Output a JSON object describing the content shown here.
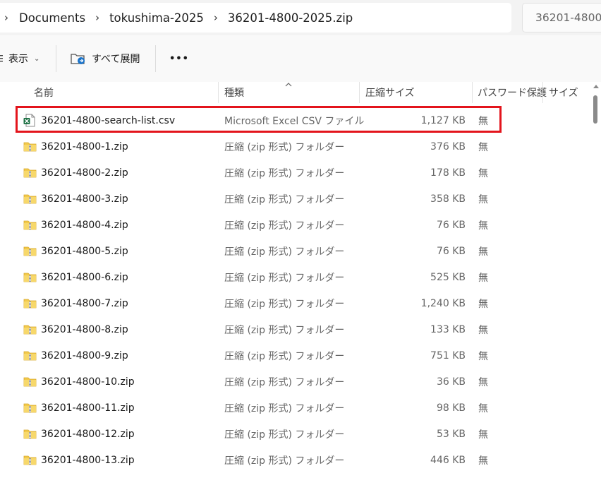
{
  "address": {
    "crumbs": [
      "Documents",
      "tokushima-2025",
      "36201-4800-2025.zip"
    ],
    "search_placeholder": "36201-4800"
  },
  "toolbar": {
    "view_label": "表示",
    "expand_all_label": "すべて展開",
    "more_label": "•••"
  },
  "columns": {
    "name": "名前",
    "type": "種類",
    "compressed_size": "圧縮サイズ",
    "password": "パスワード保護",
    "size": "サイズ"
  },
  "files": [
    {
      "name": "36201-4800-search-list.csv",
      "type": "Microsoft Excel CSV ファイル",
      "size": "1,127 KB",
      "password": "無",
      "icon": "excel-csv-icon"
    },
    {
      "name": "36201-4800-1.zip",
      "type": "圧縮 (zip 形式) フォルダー",
      "size": "376 KB",
      "password": "無",
      "icon": "zip-folder-icon"
    },
    {
      "name": "36201-4800-2.zip",
      "type": "圧縮 (zip 形式) フォルダー",
      "size": "178 KB",
      "password": "無",
      "icon": "zip-folder-icon"
    },
    {
      "name": "36201-4800-3.zip",
      "type": "圧縮 (zip 形式) フォルダー",
      "size": "358 KB",
      "password": "無",
      "icon": "zip-folder-icon"
    },
    {
      "name": "36201-4800-4.zip",
      "type": "圧縮 (zip 形式) フォルダー",
      "size": "76 KB",
      "password": "無",
      "icon": "zip-folder-icon"
    },
    {
      "name": "36201-4800-5.zip",
      "type": "圧縮 (zip 形式) フォルダー",
      "size": "76 KB",
      "password": "無",
      "icon": "zip-folder-icon"
    },
    {
      "name": "36201-4800-6.zip",
      "type": "圧縮 (zip 形式) フォルダー",
      "size": "525 KB",
      "password": "無",
      "icon": "zip-folder-icon"
    },
    {
      "name": "36201-4800-7.zip",
      "type": "圧縮 (zip 形式) フォルダー",
      "size": "1,240 KB",
      "password": "無",
      "icon": "zip-folder-icon"
    },
    {
      "name": "36201-4800-8.zip",
      "type": "圧縮 (zip 形式) フォルダー",
      "size": "133 KB",
      "password": "無",
      "icon": "zip-folder-icon"
    },
    {
      "name": "36201-4800-9.zip",
      "type": "圧縮 (zip 形式) フォルダー",
      "size": "751 KB",
      "password": "無",
      "icon": "zip-folder-icon"
    },
    {
      "name": "36201-4800-10.zip",
      "type": "圧縮 (zip 形式) フォルダー",
      "size": "36 KB",
      "password": "無",
      "icon": "zip-folder-icon"
    },
    {
      "name": "36201-4800-11.zip",
      "type": "圧縮 (zip 形式) フォルダー",
      "size": "98 KB",
      "password": "無",
      "icon": "zip-folder-icon"
    },
    {
      "name": "36201-4800-12.zip",
      "type": "圧縮 (zip 形式) フォルダー",
      "size": "53 KB",
      "password": "無",
      "icon": "zip-folder-icon"
    },
    {
      "name": "36201-4800-13.zip",
      "type": "圧縮 (zip 形式) フォルダー",
      "size": "446 KB",
      "password": "無",
      "icon": "zip-folder-icon"
    }
  ],
  "colors": {
    "highlight": "#e3141c",
    "folder_yellow": "#f2c94c",
    "excel_green": "#1e7145"
  }
}
